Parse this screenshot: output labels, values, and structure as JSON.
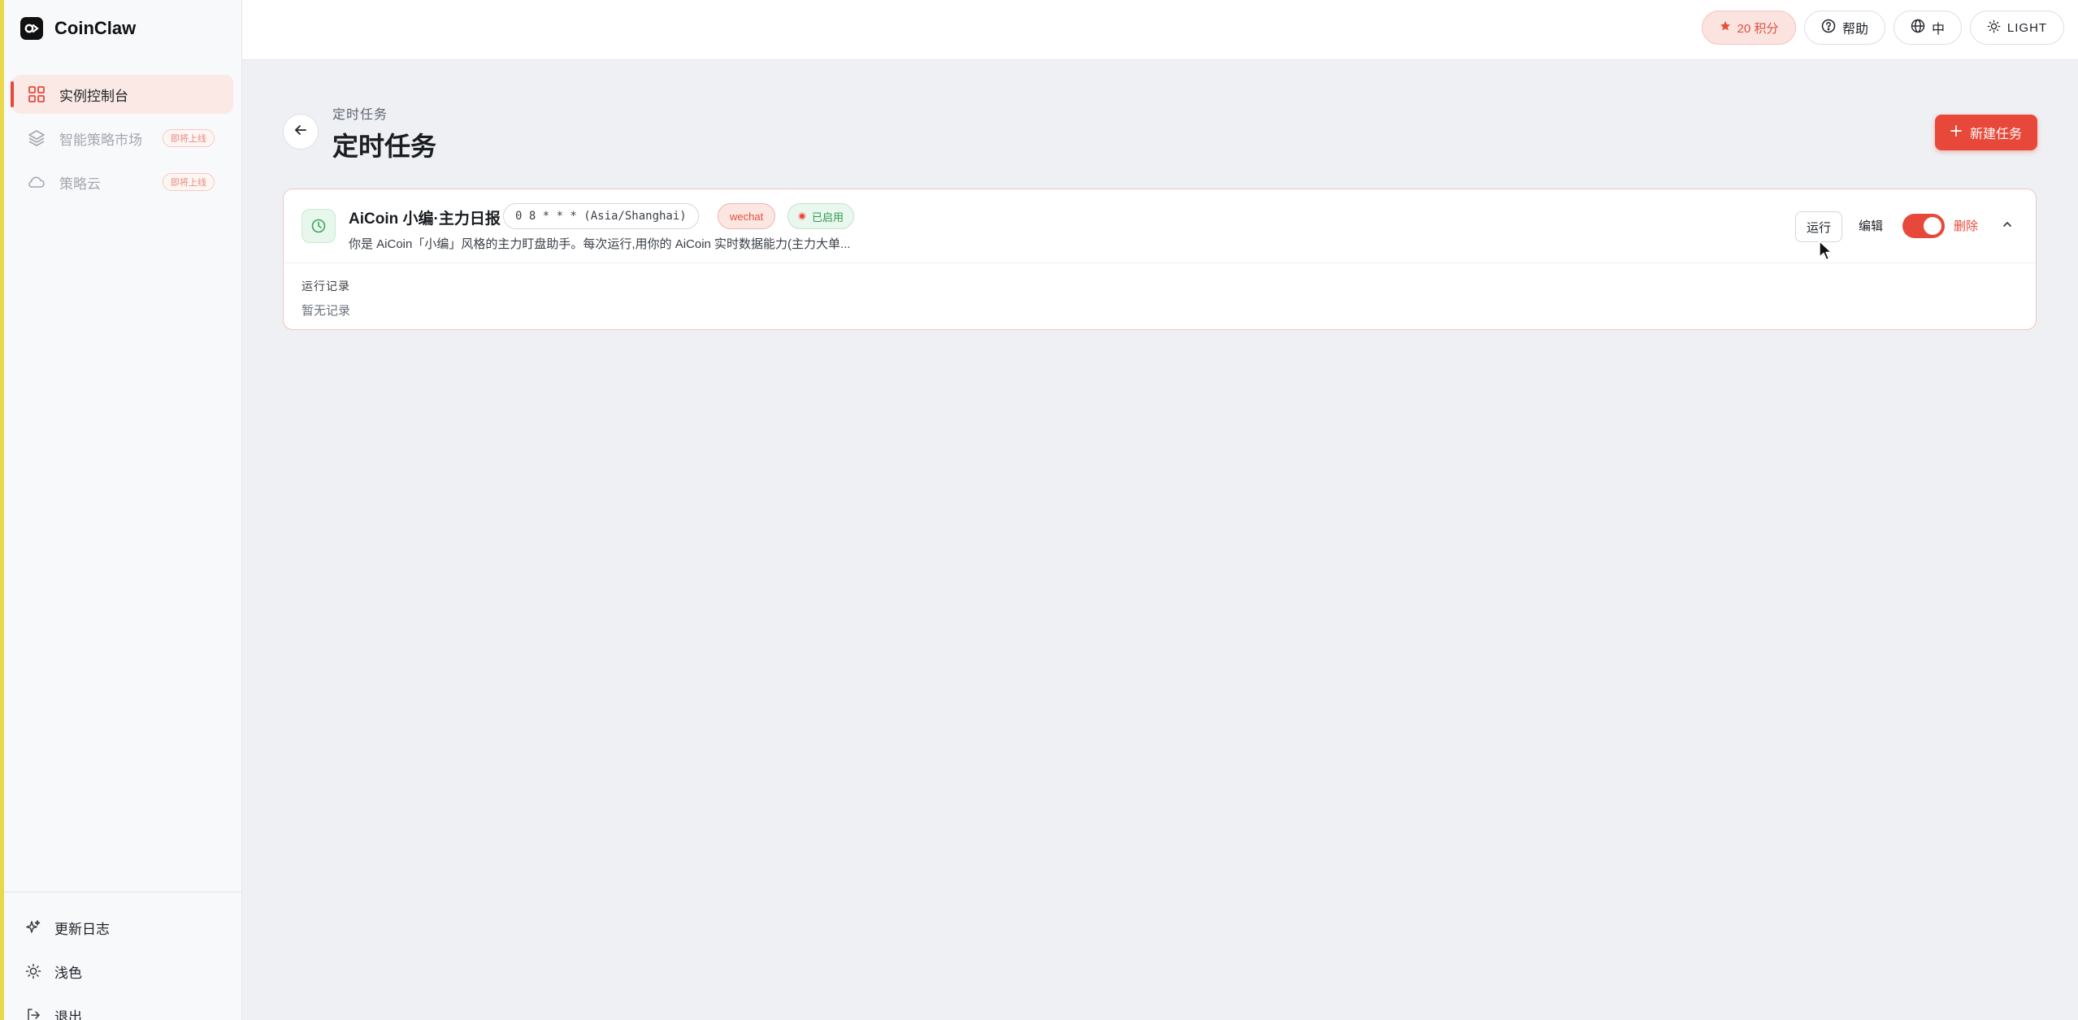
{
  "app": {
    "name": "CoinClaw"
  },
  "sidebar": {
    "items": [
      {
        "label": "实例控制台",
        "active": true
      },
      {
        "label": "智能策略市场",
        "badge": "即将上线",
        "disabled": true
      },
      {
        "label": "策略云",
        "badge": "即将上线",
        "disabled": true
      }
    ],
    "bottom": [
      {
        "label": "更新日志"
      },
      {
        "label": "浅色"
      },
      {
        "label": "退出"
      }
    ]
  },
  "topbar": {
    "points_label": "20 积分",
    "help_label": "帮助",
    "lang_label": "中",
    "theme_label": "LIGHT"
  },
  "page": {
    "breadcrumb": "定时任务",
    "title": "定时任务",
    "new_button_label": "新建任务"
  },
  "task": {
    "name": "AiCoin 小编·主力日报",
    "cron": "0 8 * * * (Asia/Shanghai)",
    "channel": "wechat",
    "status": "已启用",
    "description": "你是 AiCoin「小编」风格的主力盯盘助手。每次运行,用你的 AiCoin 实时数据能力(主力大单...",
    "run_label": "运行",
    "edit_label": "编辑",
    "delete_label": "删除",
    "enabled": true,
    "log_title": "运行记录",
    "log_empty": "暂无记录"
  },
  "colors": {
    "accent": "#e8483a",
    "success": "#2f9a4f",
    "sidebar_bg": "#f8f9fb",
    "page_bg": "#eef0f3"
  }
}
